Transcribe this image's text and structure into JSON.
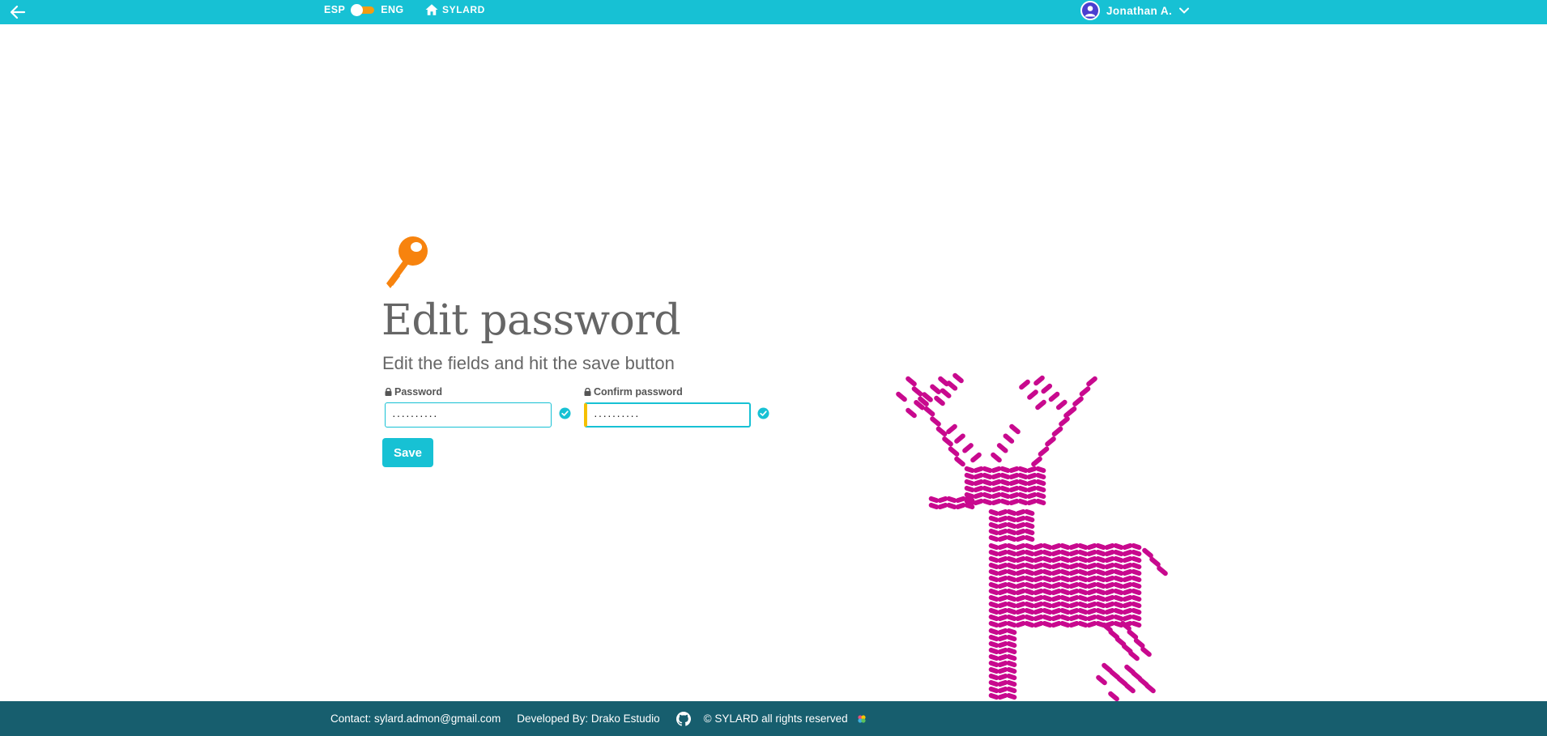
{
  "topbar": {
    "lang_left": "ESP",
    "lang_right": "ENG",
    "home_label": "SYLARD",
    "user_name": "Jonathan A.",
    "bg_color": "#17c1d4",
    "toggle_color": "#f39c12"
  },
  "main": {
    "title": "Edit password",
    "subtitle": "Edit the fields and hit the save button",
    "password_label": "Password",
    "password_value": "··········",
    "confirm_label": "Confirm password",
    "confirm_value": "··········",
    "save_label": "Save",
    "key_color": "#f7830e",
    "deer_color": "#c8098e"
  },
  "footer": {
    "contact": "Contact: sylard.admon@gmail.com",
    "developed": "Developed By: Drako Estudio",
    "rights": "© SYLARD all rights reserved",
    "bg_color": "#175e6e"
  },
  "icons": [
    "back-arrow-icon",
    "home-icon",
    "user-avatar-icon",
    "chevron-down-icon",
    "key-icon",
    "lock-icon",
    "check-circle-icon",
    "github-icon",
    "logo-icon",
    "reindeer-illustration"
  ]
}
